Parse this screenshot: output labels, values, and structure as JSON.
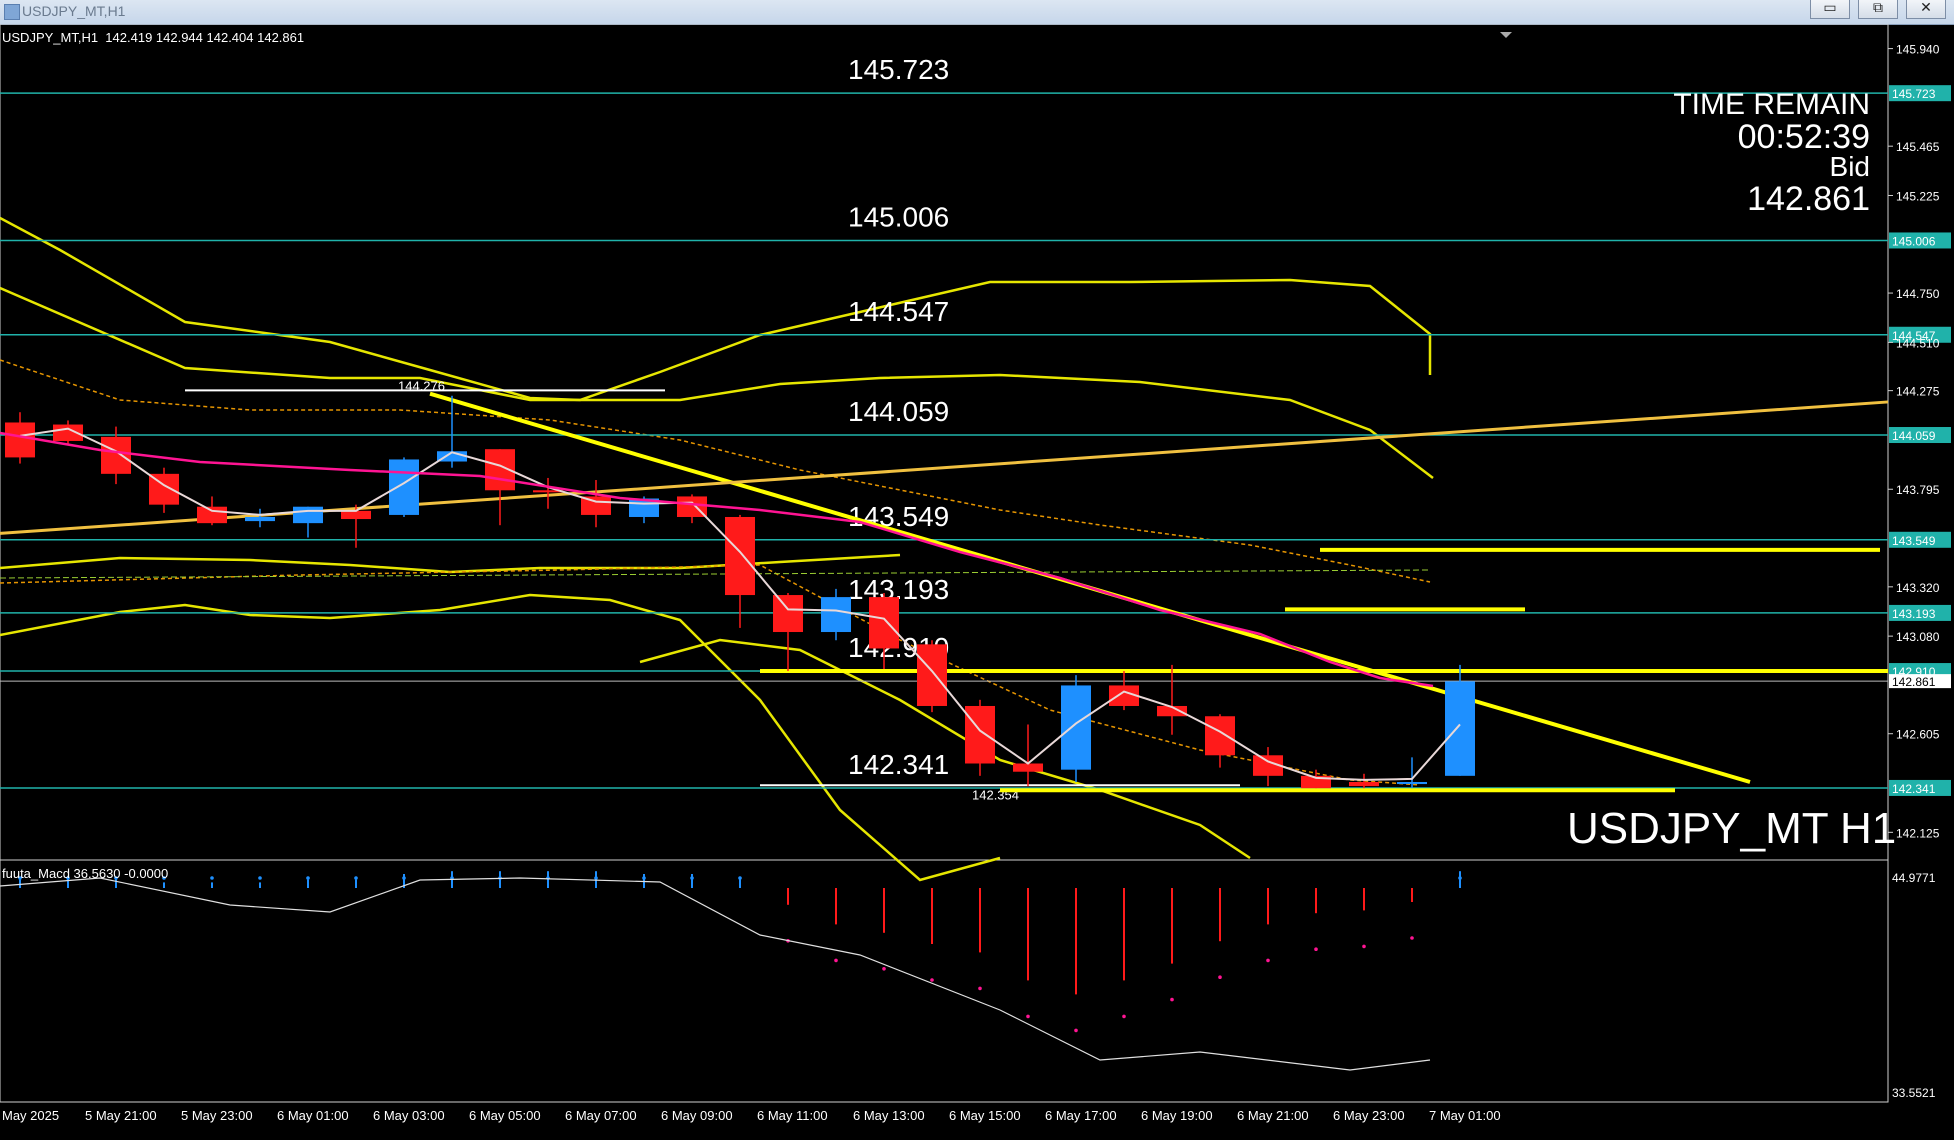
{
  "window": {
    "title": "USDJPY_MT,H1",
    "buttons": [
      "minimize-button",
      "restore-button",
      "close-button"
    ],
    "button_glyphs": [
      "▭",
      "⧉",
      "✕"
    ]
  },
  "chart_header": {
    "symbol_line": "USDJPY_MT,H1  142.419 142.944 142.404 142.861"
  },
  "time_remain": {
    "label": "TIME REMAIN",
    "value": "00:52:39",
    "bid_label": "Bid",
    "bid_value": "142.861"
  },
  "symbol_watermark": "USDJPY_MT H1",
  "macd": {
    "label": "fuuta_Macd 36.5630 -0.0000",
    "axis_top": "44.9771",
    "axis_bottom": "33.5521"
  },
  "colors": {
    "background": "#000000",
    "bull": "#1e90ff",
    "bear": "#ff1a1a",
    "level_line": "#20b2aa",
    "trend": "#ffff00",
    "band": "#e6e600",
    "ma_pink": "#ff1493",
    "ma_white": "#e8d8d8",
    "price_label_bg": "#20b2aa"
  },
  "chart_data": [
    {
      "type": "candlestick",
      "title": "USDJPY_MT,H1",
      "ylim": [
        142.0,
        146.05
      ],
      "price_axis_ticks": [
        "145.940",
        "145.465",
        "145.225",
        "144.750",
        "144.510",
        "144.275",
        "143.795",
        "143.320",
        "143.080",
        "142.605",
        "142.125"
      ],
      "time_axis_labels": [
        "May 2025",
        "5 May 21:00",
        "5 May 23:00",
        "6 May 01:00",
        "6 May 03:00",
        "6 May 05:00",
        "6 May 07:00",
        "6 May 09:00",
        "6 May 11:00",
        "6 May 13:00",
        "6 May 15:00",
        "6 May 17:00",
        "6 May 19:00",
        "6 May 21:00",
        "6 May 23:00",
        "7 May 01:00"
      ],
      "horizontal_levels": [
        {
          "value": 145.723,
          "label": "145.723"
        },
        {
          "value": 145.006,
          "label": "145.006"
        },
        {
          "value": 144.547,
          "label": "144.547"
        },
        {
          "value": 144.059,
          "label": "144.059"
        },
        {
          "value": 143.549,
          "label": "143.549"
        },
        {
          "value": 143.193,
          "label": "143.193"
        },
        {
          "value": 142.91,
          "label": "142.910"
        },
        {
          "value": 142.341,
          "label": "142.341"
        }
      ],
      "current_price": {
        "value": 142.861,
        "label": "142.861"
      },
      "annotations": [
        {
          "text": "144.276",
          "value": 144.276
        },
        {
          "text": "142.354",
          "value": 142.354
        }
      ],
      "candles": [
        {
          "open": 144.12,
          "high": 144.17,
          "low": 143.92,
          "close": 143.95
        },
        {
          "open": 144.11,
          "high": 144.13,
          "low": 144.01,
          "close": 144.03
        },
        {
          "open": 144.05,
          "high": 144.1,
          "low": 143.82,
          "close": 143.87
        },
        {
          "open": 143.87,
          "high": 143.9,
          "low": 143.68,
          "close": 143.72
        },
        {
          "open": 143.71,
          "high": 143.76,
          "low": 143.62,
          "close": 143.63
        },
        {
          "open": 143.64,
          "high": 143.7,
          "low": 143.61,
          "close": 143.66
        },
        {
          "open": 143.63,
          "high": 143.71,
          "low": 143.56,
          "close": 143.71
        },
        {
          "open": 143.69,
          "high": 143.72,
          "low": 143.51,
          "close": 143.65
        },
        {
          "open": 143.67,
          "high": 143.95,
          "low": 143.66,
          "close": 143.94
        },
        {
          "open": 143.93,
          "high": 144.25,
          "low": 143.9,
          "close": 143.98
        },
        {
          "open": 143.99,
          "high": 143.99,
          "low": 143.62,
          "close": 143.79
        },
        {
          "open": 143.79,
          "high": 143.85,
          "low": 143.7,
          "close": 143.78
        },
        {
          "open": 143.76,
          "high": 143.84,
          "low": 143.61,
          "close": 143.67
        },
        {
          "open": 143.66,
          "high": 143.76,
          "low": 143.63,
          "close": 143.75
        },
        {
          "open": 143.76,
          "high": 143.77,
          "low": 143.63,
          "close": 143.66
        },
        {
          "open": 143.66,
          "high": 143.67,
          "low": 143.12,
          "close": 143.28
        },
        {
          "open": 143.28,
          "high": 143.29,
          "low": 142.91,
          "close": 143.1
        },
        {
          "open": 143.1,
          "high": 143.31,
          "low": 143.06,
          "close": 143.27
        },
        {
          "open": 143.27,
          "high": 143.29,
          "low": 142.92,
          "close": 143.02
        },
        {
          "open": 143.04,
          "high": 143.06,
          "low": 142.71,
          "close": 142.74
        },
        {
          "open": 142.74,
          "high": 142.77,
          "low": 142.4,
          "close": 142.46
        },
        {
          "open": 142.46,
          "high": 142.65,
          "low": 142.35,
          "close": 142.42
        },
        {
          "open": 142.43,
          "high": 142.89,
          "low": 142.37,
          "close": 142.84
        },
        {
          "open": 142.84,
          "high": 142.91,
          "low": 142.72,
          "close": 142.74
        },
        {
          "open": 142.74,
          "high": 142.94,
          "low": 142.6,
          "close": 142.69
        },
        {
          "open": 142.69,
          "high": 142.7,
          "low": 142.44,
          "close": 142.5
        },
        {
          "open": 142.5,
          "high": 142.54,
          "low": 142.35,
          "close": 142.4
        },
        {
          "open": 142.4,
          "high": 142.43,
          "low": 142.34,
          "close": 142.34
        },
        {
          "open": 142.37,
          "high": 142.41,
          "low": 142.34,
          "close": 142.35
        },
        {
          "open": 142.36,
          "high": 142.49,
          "low": 142.34,
          "close": 142.37
        },
        {
          "open": 142.4,
          "high": 142.94,
          "low": 142.4,
          "close": 142.86
        }
      ]
    },
    {
      "type": "bar",
      "title": "fuuta_Macd 36.5630 -0.0000",
      "ylim": [
        33.5521,
        44.9771
      ],
      "values": [
        0.3,
        0.4,
        0.3,
        0.2,
        0.2,
        0.2,
        0.3,
        0.3,
        0.5,
        0.6,
        0.6,
        0.6,
        0.6,
        0.5,
        0.5,
        0.4,
        -0.6,
        -1.3,
        -1.6,
        -2.0,
        -2.3,
        -3.3,
        -3.8,
        -3.3,
        -2.7,
        -1.9,
        -1.3,
        -0.9,
        -0.8,
        -0.5,
        0.6
      ]
    }
  ]
}
